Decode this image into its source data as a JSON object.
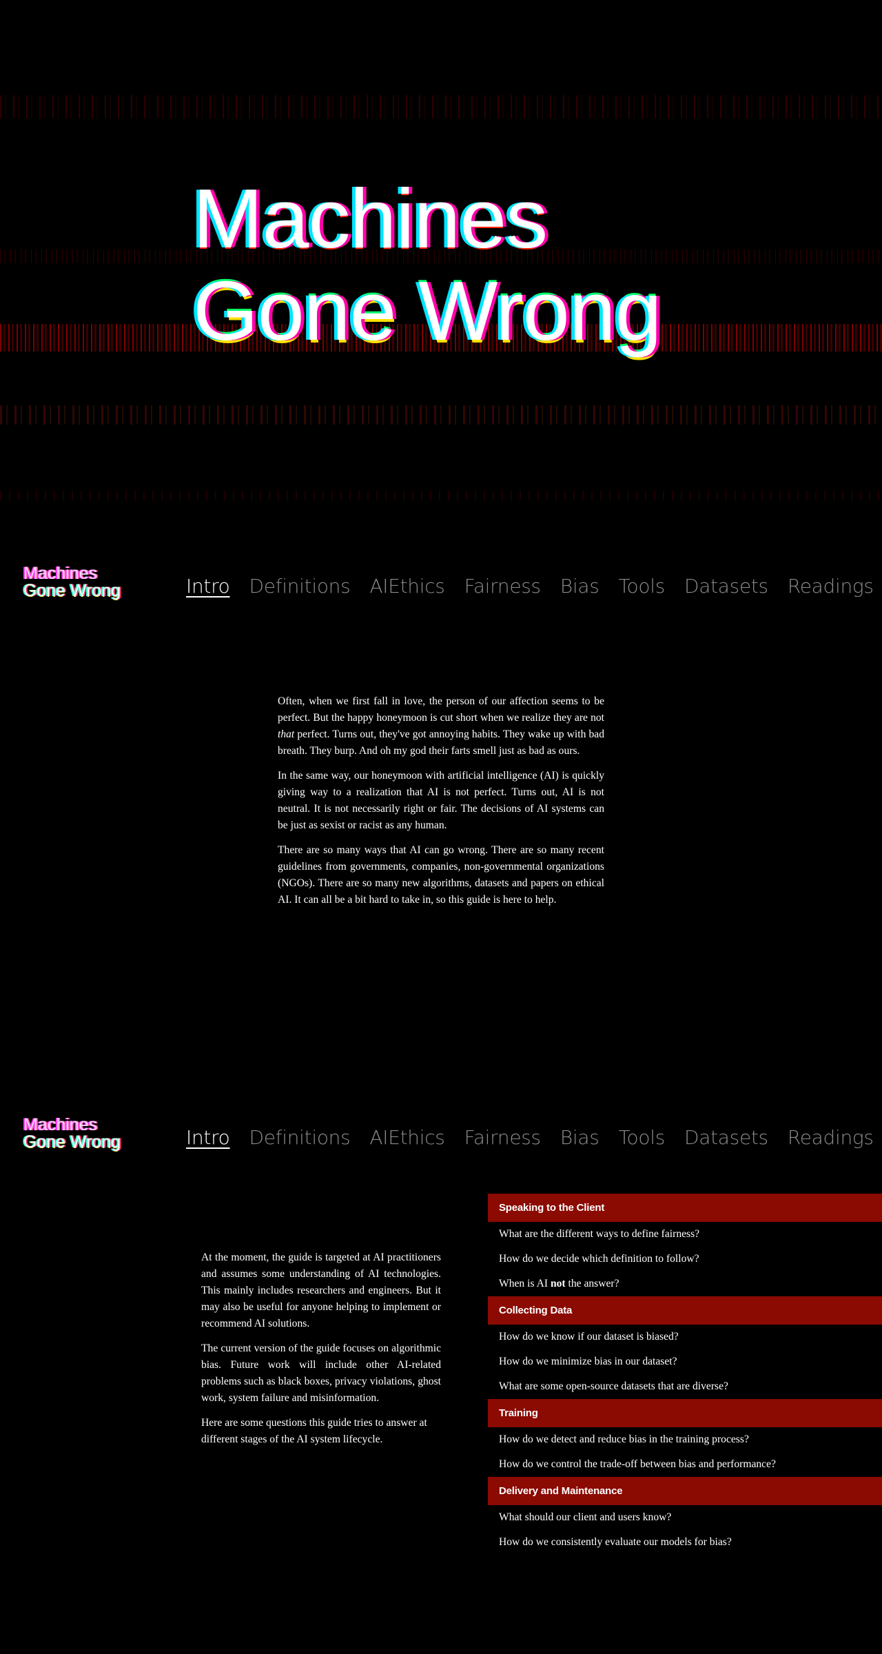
{
  "hero": {
    "title_line1": "Machines",
    "title_line2": "Gone Wrong"
  },
  "logo": {
    "line1": "Machines",
    "line2": "Gone Wrong"
  },
  "nav": {
    "items": [
      {
        "label": "Intro",
        "active": true
      },
      {
        "label": "Definitions"
      },
      {
        "label": "AIEthics"
      },
      {
        "label": "Fairness"
      },
      {
        "label": "Bias"
      },
      {
        "label": "Tools"
      },
      {
        "label": "Datasets"
      },
      {
        "label": "Readings"
      }
    ]
  },
  "intro": {
    "p1_a": "Often, when we first fall in love, the person of our affection seems to be perfect. But the happy honeymoon is cut short when we realize they are not ",
    "p1_em": "that",
    "p1_b": " perfect. Turns out, they've got annoying habits. They wake up with bad breath. They burp. And oh my god their farts smell just as bad as ours.",
    "p2": "In the same way, our honeymoon with artificial intelligence (AI) is quickly giving way to a realization that AI is not perfect. Turns out, AI is not neutral. It is not necessarily right or fair. The decisions of AI systems can be just as sexist or racist as any human.",
    "p3": "There are so many ways that AI can go wrong. There are so many recent guidelines from governments, companies, non-governmental organizations (NGOs). There are so many new algorithms, datasets and papers on ethical AI. It can all be a bit hard to take in, so this guide is here to help."
  },
  "audience": {
    "p1": "At the moment, the guide is targeted at AI practitioners and assumes some understanding of AI technologies. This mainly includes researchers and engineers. But it may also be useful for anyone helping to implement or recommend AI solutions.",
    "p2": "The current version of the guide focuses on algorithmic bias. Future work will include other AI-related problems such as black boxes, privacy violations, ghost work, system failure and misinformation.",
    "p3": "Here are some questions this guide tries to answer at different stages of the AI system lifecycle."
  },
  "lifecycle": {
    "stage1": {
      "title": "Speaking to the Client",
      "q1": "What are the different ways to define fairness?",
      "q2": "How do we decide which definition to follow?",
      "q3_a": "When is AI ",
      "q3_b": "not",
      "q3_c": " the answer?"
    },
    "stage2": {
      "title": "Collecting Data",
      "q1": "How do we know if our dataset is biased?",
      "q2": "How do we minimize bias in our dataset?",
      "q3": "What are some open-source datasets that are diverse?"
    },
    "stage3": {
      "title": "Training",
      "q1": "How do we detect and reduce bias in the training process?",
      "q2": "How do we control the trade-off between bias and performance?"
    },
    "stage4": {
      "title": "Delivery and Maintenance",
      "q1": "What should our client and users know?",
      "q2": "How do we consistently evaluate our models for bias?"
    }
  },
  "colors": {
    "background": "#000000",
    "stage_header": "#8b0a02",
    "nav_inactive": "#8c8c8c",
    "nav_active": "#ffffff"
  }
}
